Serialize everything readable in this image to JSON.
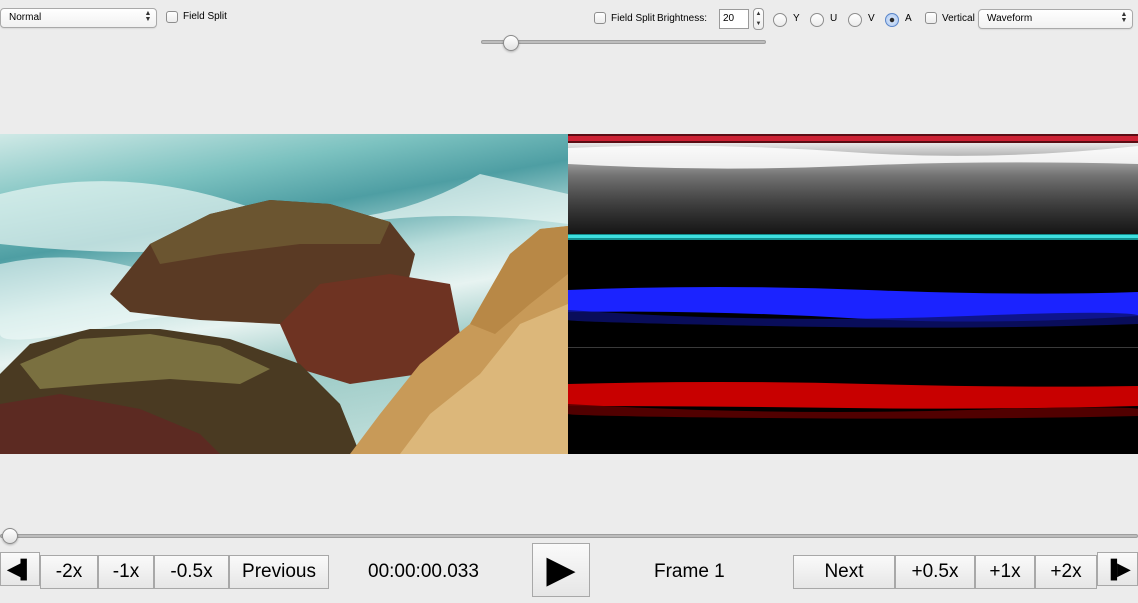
{
  "toolbar": {
    "mode_select": {
      "value": "Normal"
    },
    "left_field_split_label": "Field Split",
    "right_field_split_label": "Field Split",
    "brightness_label": "Brightness:",
    "brightness_value": "20",
    "channel_options": [
      {
        "label": "Y",
        "selected": false
      },
      {
        "label": "U",
        "selected": false
      },
      {
        "label": "V",
        "selected": false
      },
      {
        "label": "A",
        "selected": true
      }
    ],
    "vertical_label": "Vertical",
    "scope_select": {
      "value": "Waveform"
    },
    "brightness_slider_fraction": 0.1
  },
  "timeline": {
    "position_fraction": 0.0
  },
  "controls": {
    "step_back_icon": "step-back-icon",
    "minus_2x": "-2x",
    "minus_1x": "-1x",
    "minus_half": "-0.5x",
    "previous": "Previous",
    "timecode": "00:00:00.033",
    "play_icon": "play-icon",
    "frame_label": "Frame 1",
    "next": "Next",
    "plus_half": "+0.5x",
    "plus_1x": "+1x",
    "plus_2x": "+2x",
    "step_forward_icon": "step-forward-icon"
  },
  "colors": {
    "waveform_red": "#e2263a",
    "waveform_cyan": "#3ee0e0",
    "waveform_blue": "#1b23ff",
    "waveform_red_band": "#c80000"
  }
}
